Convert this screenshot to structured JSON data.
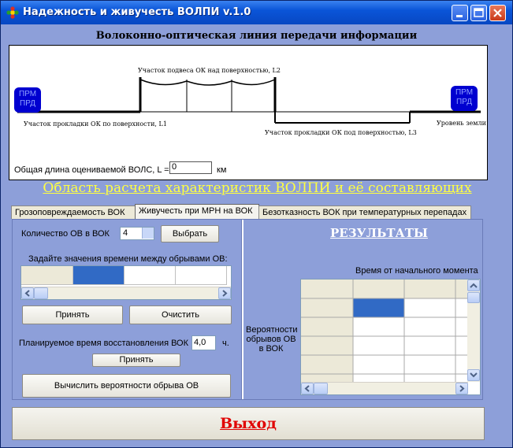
{
  "window": {
    "title": "Надежность и живучесть ВОЛПИ v.1.0"
  },
  "diagram": {
    "title": "Волоконно-оптическая линия передачи информации",
    "node_left": "ПРМ\nПРД",
    "node_right": "ПРМ\nПРД",
    "label_suspension": "Участок подвеса ОК над поверхностью, L2",
    "label_surface": "Участок прокладки ОК по поверхности, L1",
    "label_underground": "Участок прокладки ОК под поверхностью, L3",
    "label_ground": "Уровень земли",
    "length_label": "Общая длина оцениваемой ВОЛС, L =",
    "length_value": "0",
    "length_unit": "км"
  },
  "area_title": "Область расчета характеристик ВОЛПИ и её составляющих",
  "tabs": [
    {
      "label": "Грозоповреждаемость ВОК",
      "active": false
    },
    {
      "label": "Живучесть при МРН на ВОК",
      "active": true
    },
    {
      "label": "Безотказность ВОК при температурных перепадах",
      "active": false
    }
  ],
  "left_panel": {
    "fiber_count_label": "Количество ОВ в ВОК",
    "fiber_count_value": "4",
    "select_button": "Выбрать",
    "time_prompt": "Задайте значения времени между обрывами ОВ:",
    "accept_button": "Принять",
    "clear_button": "Очистить",
    "restore_label": "Планируемое время восстановления ВОК",
    "restore_value": "4,0",
    "restore_unit": "ч.",
    "accept_button2": "Принять",
    "compute_button": "Вычислить вероятности обрыва ОВ"
  },
  "right_panel": {
    "title": "РЕЗУЛЬТАТЫ",
    "column_caption": "Время от начального момента",
    "row_caption": "Вероятности обрывов ОВ в ВОК"
  },
  "exit_button": "Выход",
  "colors": {
    "window_bg": "#8d9fd9",
    "accent_yellow": "#ffff40",
    "exit_red": "#e00000",
    "selection": "#316ac5"
  }
}
